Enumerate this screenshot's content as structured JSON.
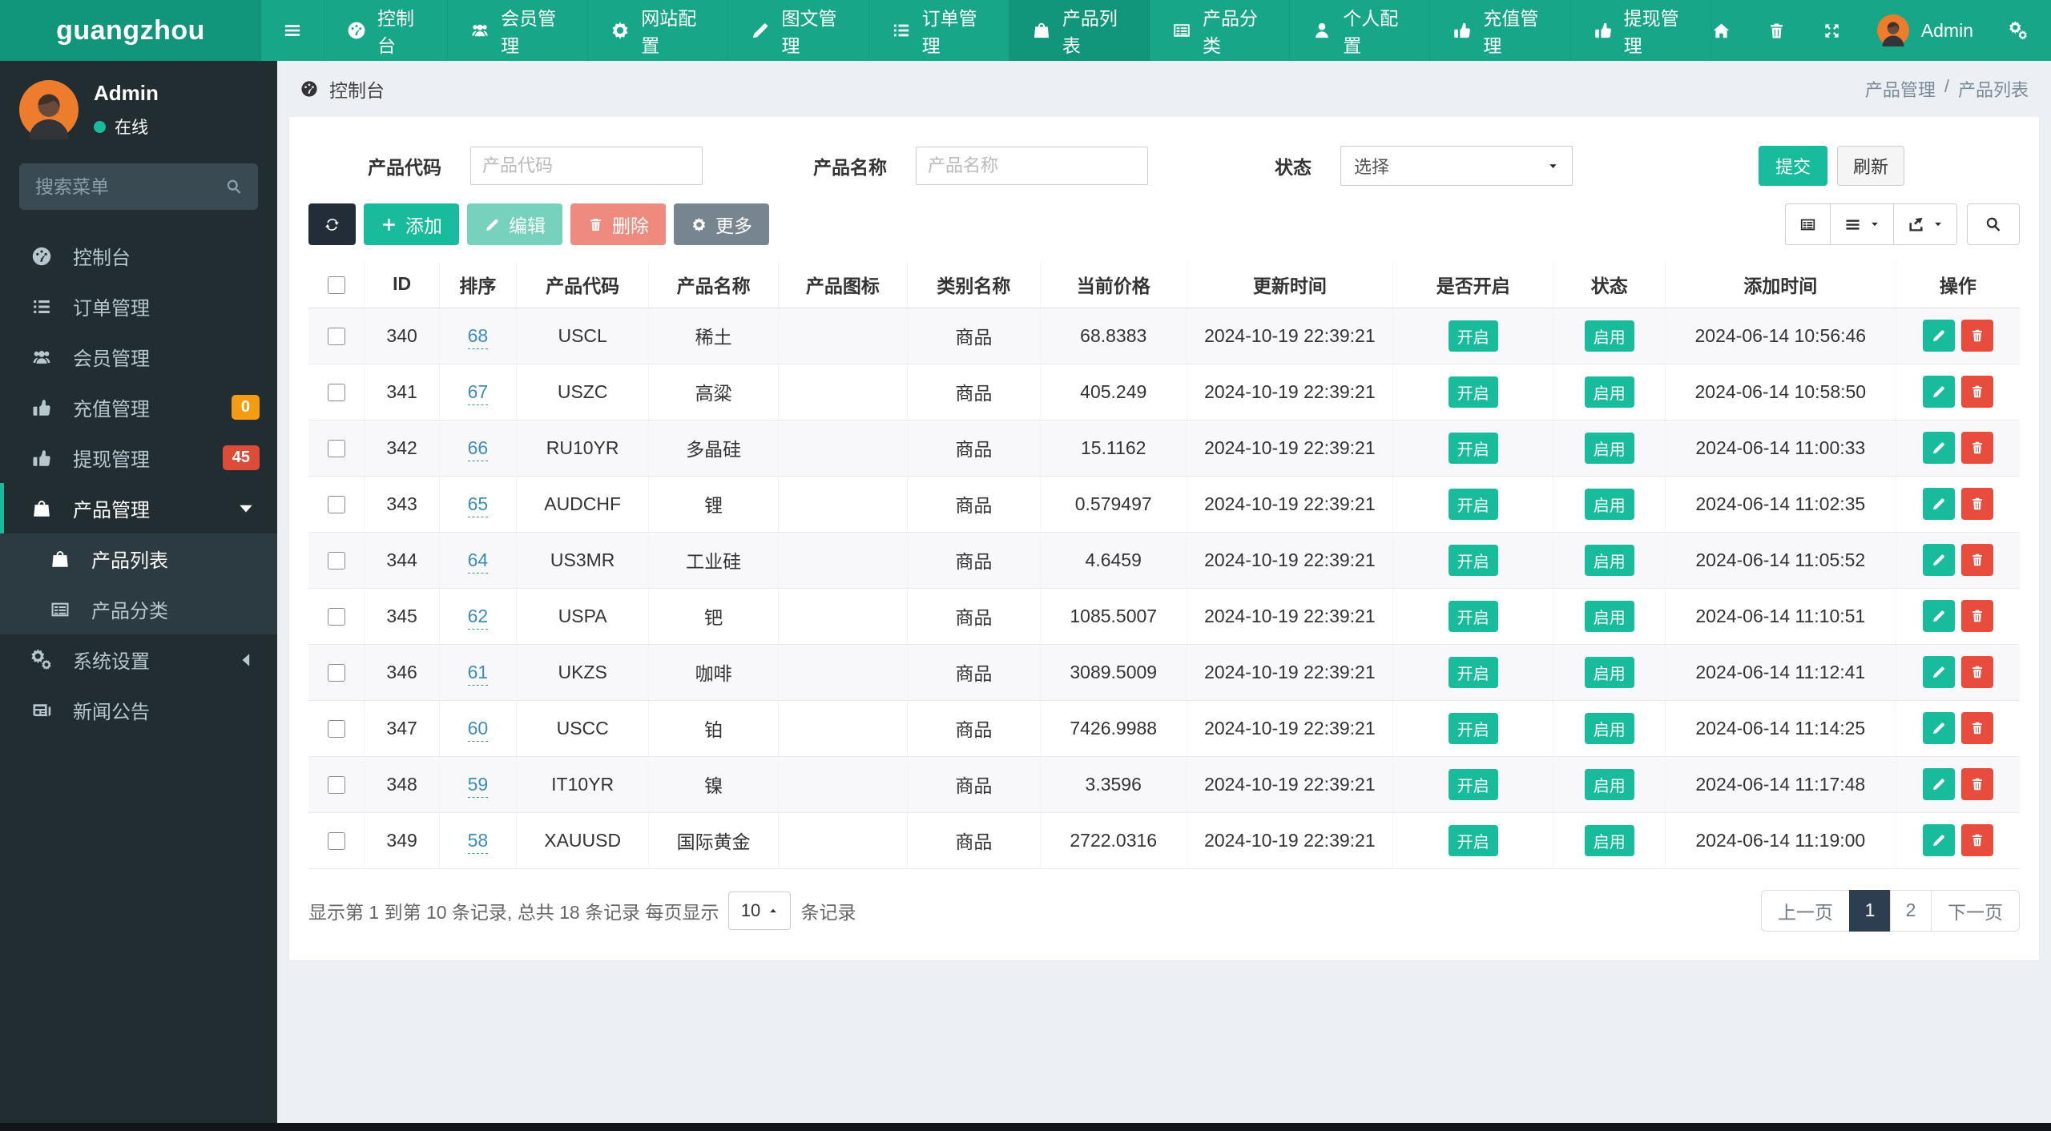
{
  "colors": {
    "navbar": "#18a689",
    "navbarDark": "#11967c",
    "sidebar": "#222d32",
    "sidebarSub": "#2c3b41",
    "accent": "#18bc9c",
    "warning": "#f39c12",
    "danger": "#dd4b39",
    "btnDanger": "#e74c3c",
    "pageActive": "#2c3e50",
    "link": "#3c8dbc"
  },
  "brand": "guangzhou",
  "topnav": {
    "user": "Admin",
    "items": [
      {
        "label": "控制台",
        "icon": "gauge"
      },
      {
        "label": "会员管理",
        "icon": "users"
      },
      {
        "label": "网站配置",
        "icon": "gear"
      },
      {
        "label": "图文管理",
        "icon": "pencil"
      },
      {
        "label": "订单管理",
        "icon": "list"
      },
      {
        "label": "产品列表",
        "icon": "bag",
        "active": true
      },
      {
        "label": "产品分类",
        "icon": "grid"
      },
      {
        "label": "个人配置",
        "icon": "person"
      },
      {
        "label": "充值管理",
        "icon": "thumb"
      },
      {
        "label": "提现管理",
        "icon": "thumb"
      }
    ]
  },
  "sidebar": {
    "user": {
      "name": "Admin",
      "status": "在线"
    },
    "search_placeholder": "搜索菜单",
    "items": [
      {
        "label": "控制台",
        "icon": "gauge"
      },
      {
        "label": "订单管理",
        "icon": "list"
      },
      {
        "label": "会员管理",
        "icon": "users"
      },
      {
        "label": "充值管理",
        "icon": "thumb",
        "badge": "0",
        "badge_color": "#f39c12"
      },
      {
        "label": "提现管理",
        "icon": "thumb",
        "badge": "45",
        "badge_color": "#dd4b39"
      },
      {
        "label": "产品管理",
        "icon": "bag",
        "active": true,
        "chevron": "caret-d"
      },
      {
        "label": "产品列表",
        "icon": "bag",
        "sub": true,
        "active": true
      },
      {
        "label": "产品分类",
        "icon": "grid",
        "sub": true
      },
      {
        "label": "系统设置",
        "icon": "gears",
        "chevron": "caret-l"
      },
      {
        "label": "新闻公告",
        "icon": "news"
      }
    ]
  },
  "breadcrumb": {
    "left": "控制台",
    "right_parent": "产品管理",
    "right_sep": "/",
    "right_current": "产品列表"
  },
  "filters": {
    "code_label": "产品代码",
    "code_placeholder": "产品代码",
    "name_label": "产品名称",
    "name_placeholder": "产品名称",
    "status_label": "状态",
    "status_value": "选择",
    "submit": "提交",
    "refresh": "刷新"
  },
  "toolbar": {
    "add": "添加",
    "edit": "编辑",
    "delete": "删除",
    "more": "更多"
  },
  "table": {
    "columns": [
      "ID",
      "排序",
      "产品代码",
      "产品名称",
      "产品图标",
      "类别名称",
      "当前价格",
      "更新时间",
      "是否开启",
      "状态",
      "添加时间",
      "操作"
    ],
    "open_badge": "开启",
    "status_badge": "启用",
    "rows": [
      {
        "id": "340",
        "sort": "68",
        "code": "USCL",
        "name": "稀土",
        "category": "商品",
        "price": "68.8383",
        "updated": "2024-10-19 22:39:21",
        "added": "2024-06-14 10:56:46"
      },
      {
        "id": "341",
        "sort": "67",
        "code": "USZC",
        "name": "高粱",
        "category": "商品",
        "price": "405.249",
        "updated": "2024-10-19 22:39:21",
        "added": "2024-06-14 10:58:50"
      },
      {
        "id": "342",
        "sort": "66",
        "code": "RU10YR",
        "name": "多晶硅",
        "category": "商品",
        "price": "15.1162",
        "updated": "2024-10-19 22:39:21",
        "added": "2024-06-14 11:00:33"
      },
      {
        "id": "343",
        "sort": "65",
        "code": "AUDCHF",
        "name": "锂",
        "category": "商品",
        "price": "0.579497",
        "updated": "2024-10-19 22:39:21",
        "added": "2024-06-14 11:02:35"
      },
      {
        "id": "344",
        "sort": "64",
        "code": "US3MR",
        "name": "工业硅",
        "category": "商品",
        "price": "4.6459",
        "updated": "2024-10-19 22:39:21",
        "added": "2024-06-14 11:05:52"
      },
      {
        "id": "345",
        "sort": "62",
        "code": "USPA",
        "name": "钯",
        "category": "商品",
        "price": "1085.5007",
        "updated": "2024-10-19 22:39:21",
        "added": "2024-06-14 11:10:51"
      },
      {
        "id": "346",
        "sort": "61",
        "code": "UKZS",
        "name": "咖啡",
        "category": "商品",
        "price": "3089.5009",
        "updated": "2024-10-19 22:39:21",
        "added": "2024-06-14 11:12:41"
      },
      {
        "id": "347",
        "sort": "60",
        "code": "USCC",
        "name": "铂",
        "category": "商品",
        "price": "7426.9988",
        "updated": "2024-10-19 22:39:21",
        "added": "2024-06-14 11:14:25"
      },
      {
        "id": "348",
        "sort": "59",
        "code": "IT10YR",
        "name": "镍",
        "category": "商品",
        "price": "3.3596",
        "updated": "2024-10-19 22:39:21",
        "added": "2024-06-14 11:17:48"
      },
      {
        "id": "349",
        "sort": "58",
        "code": "XAUUSD",
        "name": "国际黄金",
        "category": "商品",
        "price": "2722.0316",
        "updated": "2024-10-19 22:39:21",
        "added": "2024-06-14 11:19:00"
      }
    ]
  },
  "footer": {
    "summary_prefix": "显示第 1 到第 10 条记录, 总共 18 条记录 每页显示",
    "page_size": "10",
    "summary_suffix": "条记录",
    "pagination": {
      "prev": "上一页",
      "next": "下一页",
      "pages": [
        {
          "label": "1",
          "active": true
        },
        {
          "label": "2"
        }
      ]
    }
  }
}
